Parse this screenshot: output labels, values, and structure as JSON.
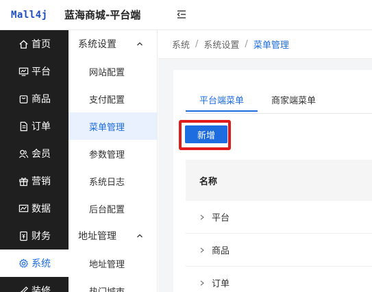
{
  "header": {
    "logo_text": "Mall4j",
    "title": "蓝海商城-平台端"
  },
  "sidebar1": {
    "items": [
      {
        "label": "首页",
        "icon": "home-icon"
      },
      {
        "label": "平台",
        "icon": "monitor-icon"
      },
      {
        "label": "商品",
        "icon": "shopping-bag-icon"
      },
      {
        "label": "订单",
        "icon": "document-icon"
      },
      {
        "label": "会员",
        "icon": "users-icon"
      },
      {
        "label": "营销",
        "icon": "gift-icon"
      },
      {
        "label": "数据",
        "icon": "chart-icon"
      },
      {
        "label": "财务",
        "icon": "finance-icon"
      },
      {
        "label": "系统",
        "icon": "gear-icon",
        "active": true
      },
      {
        "label": "装修",
        "icon": "brush-icon"
      }
    ]
  },
  "sidebar2": {
    "group1": "系统设置",
    "group1_items": [
      "网站配置",
      "支付配置",
      "菜单管理",
      "参数管理",
      "系统日志",
      "后台配置"
    ],
    "group2": "地址管理",
    "group2_items": [
      "地址管理",
      "热门城市"
    ]
  },
  "breadcrumb": {
    "items": [
      "系统",
      "系统设置",
      "菜单管理"
    ]
  },
  "tabs": [
    "平台端菜单",
    "商家端菜单"
  ],
  "add_button": "新增",
  "table": {
    "header_name": "名称",
    "rows": [
      "平台",
      "商品",
      "订单"
    ]
  },
  "colors": {
    "accent": "#1d6ce0",
    "sidebar_bg": "#1f1f1f",
    "highlight": "#e11b1b"
  }
}
